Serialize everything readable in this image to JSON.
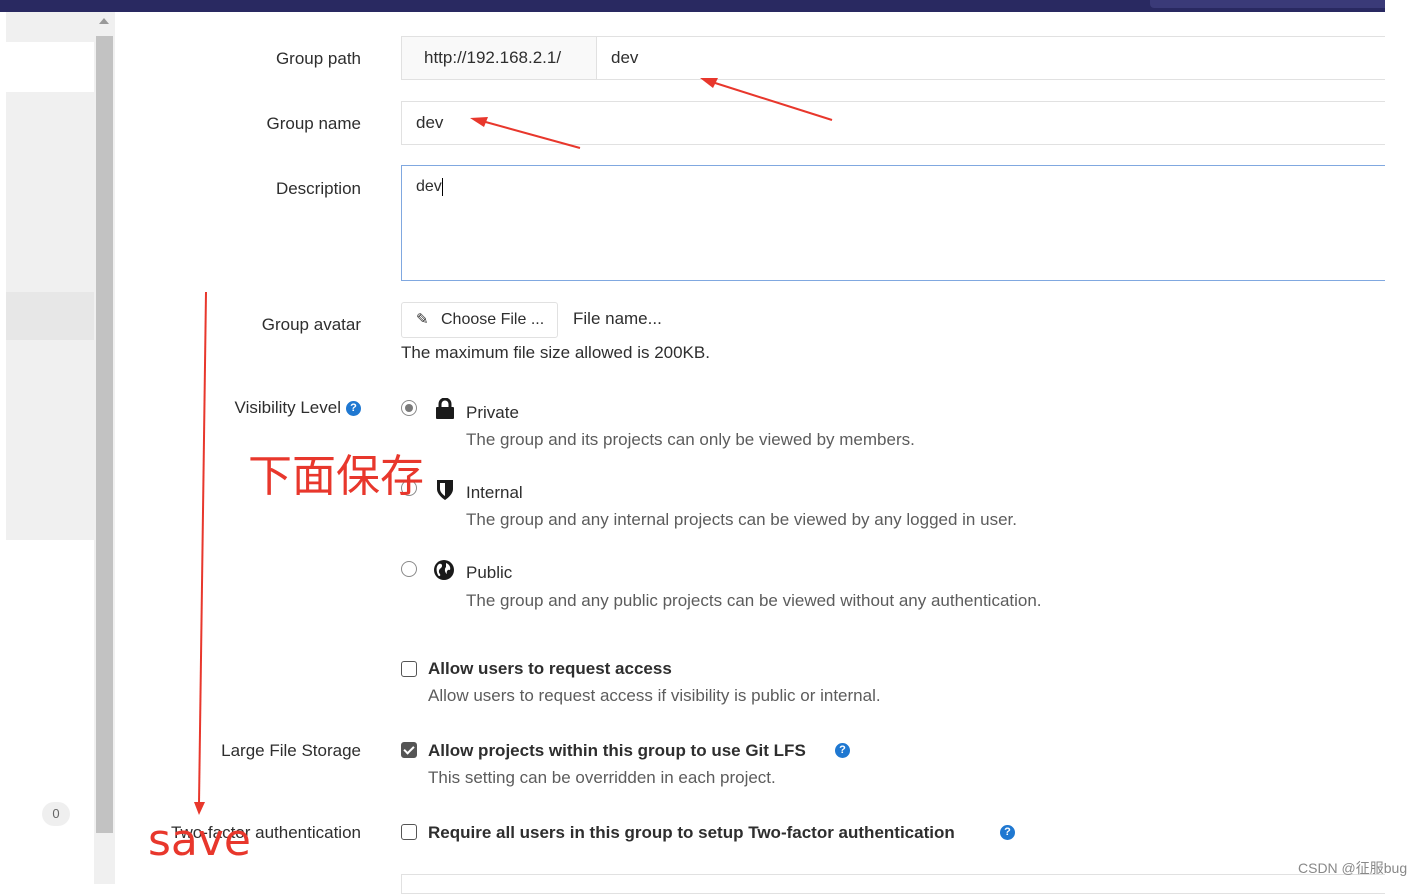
{
  "form": {
    "group_path": {
      "label": "Group path",
      "prefix": "http://192.168.2.1/",
      "value": "dev"
    },
    "group_name": {
      "label": "Group name",
      "value": "dev"
    },
    "description": {
      "label": "Description",
      "value": "dev"
    },
    "group_avatar": {
      "label": "Group avatar",
      "button_label": "Choose File ...",
      "file_name": "File name...",
      "hint": "The maximum file size allowed is 200KB."
    },
    "visibility": {
      "label": "Visibility Level",
      "selected": "Private",
      "options": [
        {
          "title": "Private",
          "description": "The group and its projects can only be viewed by members.",
          "icon": "lock-icon"
        },
        {
          "title": "Internal",
          "description": "The group and any internal projects can be viewed by any logged in user.",
          "icon": "shield-icon"
        },
        {
          "title": "Public",
          "description": "The group and any public projects can be viewed without any authentication.",
          "icon": "globe-icon"
        }
      ]
    },
    "request_access": {
      "title": "Allow users to request access",
      "description": "Allow users to request access if visibility is public or internal.",
      "checked": false
    },
    "lfs": {
      "label": "Large File Storage",
      "title": "Allow projects within this group to use Git LFS",
      "description": "This setting can be overridden in each project.",
      "checked": true
    },
    "two_factor": {
      "label": "Two-factor authentication",
      "title": "Require all users in this group to setup Two-factor authentication",
      "checked": false
    }
  },
  "sidebar": {
    "badge_count": "0"
  },
  "annotations": {
    "chinese_note": "下面保存",
    "save_note": "save"
  },
  "watermark": "CSDN @征服bug",
  "colors": {
    "annotation": "#e8372c",
    "topbar": "#292961",
    "help_icon": "#1f78d1"
  }
}
